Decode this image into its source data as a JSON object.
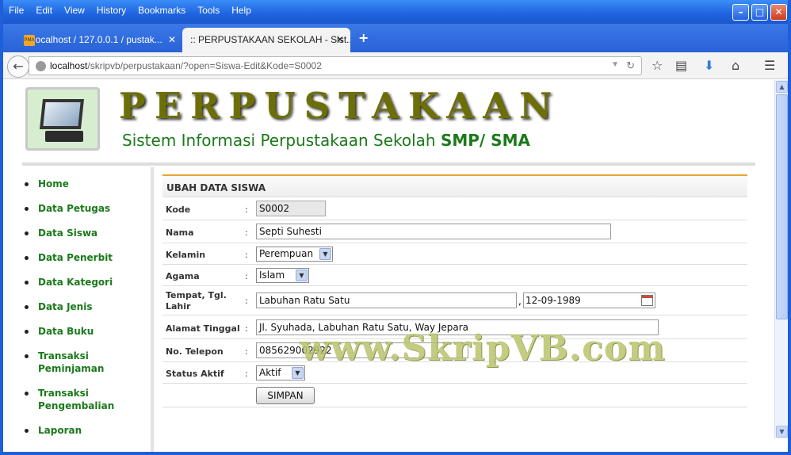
{
  "browser": {
    "menu": [
      "File",
      "Edit",
      "View",
      "History",
      "Bookmarks",
      "Tools",
      "Help"
    ],
    "tabs": [
      {
        "label": "localhost / 127.0.0.1 / pustak..."
      },
      {
        "label": ":: PERPUSTAKAAN SEKOLAH - Sist..."
      }
    ],
    "url_host": "localhost",
    "url_path": "/skripvb/perpustakaan/?open=Siswa-Edit&Kode=S0002",
    "controls": {
      "minimize": "–",
      "maximize": "□",
      "close": "✕",
      "new_tab": "+",
      "tab_close": "✕"
    }
  },
  "header": {
    "title": "PERPUSTAKAAN",
    "subtitle_plain": "Sistem Informasi Perpustakaan Sekolah ",
    "subtitle_bold": "SMP/ SMA"
  },
  "sidebar": {
    "items": [
      {
        "label": "Home"
      },
      {
        "label": "Data Petugas"
      },
      {
        "label": "Data Siswa"
      },
      {
        "label": "Data Penerbit"
      },
      {
        "label": "Data Kategori"
      },
      {
        "label": "Data Jenis"
      },
      {
        "label": "Data Buku"
      },
      {
        "label": "Transaksi Peminjaman"
      },
      {
        "label": "Transaksi Pengembalian"
      },
      {
        "label": "Laporan"
      }
    ]
  },
  "form": {
    "heading": "UBAH DATA SISWA",
    "colon": ":",
    "labels": {
      "kode": "Kode",
      "nama": "Nama",
      "kelamin": "Kelamin",
      "agama": "Agama",
      "tempat_tgl": "Tempat, Tgl. Lahir",
      "alamat": "Alamat Tinggal",
      "telepon": "No. Telepon",
      "status": "Status Aktif"
    },
    "values": {
      "kode": "S0002",
      "nama": "Septi Suhesti",
      "kelamin": "Perempuan",
      "agama": "Islam",
      "tempat": "Labuhan Ratu Satu",
      "comma": ",",
      "tgl_lahir": "12-09-1989",
      "alamat": "Jl. Syuhada, Labuhan Ratu Satu, Way Jepara",
      "telepon": "085629002922",
      "status": "Aktif"
    },
    "submit_label": "SIMPAN"
  },
  "watermark": "www.SkripVB.com",
  "colors": {
    "accent_green": "#1b7a1b",
    "title_olive": "#6c6f05",
    "panel_border": "#e7a533",
    "titlebar_blue": "#1f63de"
  }
}
